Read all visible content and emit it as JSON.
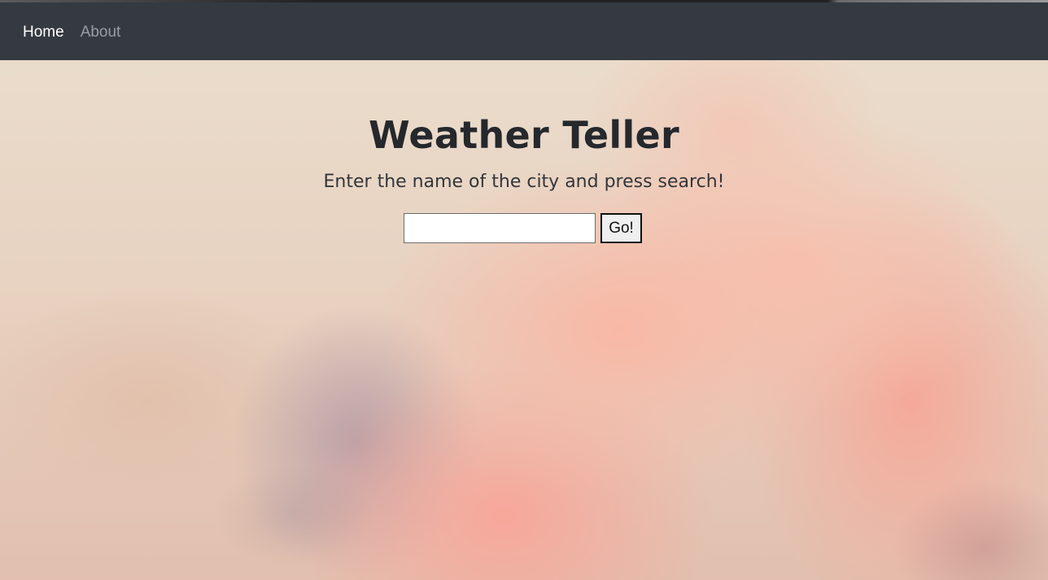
{
  "nav": {
    "items": [
      {
        "label": "Home",
        "active": true
      },
      {
        "label": "About",
        "active": false
      }
    ]
  },
  "hero": {
    "title": "Weather Teller",
    "subtitle": "Enter the name of the city and press search!",
    "search": {
      "value": "",
      "placeholder": "",
      "button_label": "Go!"
    }
  },
  "colors": {
    "navbar": "#343a40",
    "nav_active": "#ffffff",
    "nav_inactive": "#9a9da0",
    "title": "#25282c"
  }
}
